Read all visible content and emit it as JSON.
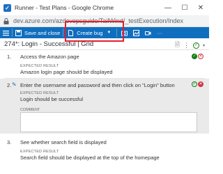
{
  "window": {
    "title": "Runner - Test Plans - Google Chrome",
    "url": "dev.azure.com/azdevopsguide/TailWind/_testExecution/Index",
    "minimize": "—",
    "maximize": "☐",
    "close": "✕"
  },
  "toolbar": {
    "save_close_label": "Save and close",
    "create_bug_label": "Create bug",
    "highlight_color": "#e81c2a"
  },
  "header": {
    "title": "274*: Login - Successful | Grid"
  },
  "steps": [
    {
      "number": "1.",
      "action": "Access the Amazon page",
      "expected_label": "EXPECTED RESULT",
      "expected": "Amazon login page should be displayed",
      "status": "passed"
    },
    {
      "number": "2.",
      "action": "Enter the username and password and then click on \"Login\" button",
      "expected_label": "EXPECTED RESULT",
      "expected": "Login should be successful",
      "comment_label": "COMMENT",
      "status": "failed"
    },
    {
      "number": "3.",
      "action": "See whether search field is displayed",
      "expected_label": "EXPECTED RESULT",
      "expected": "Search field should be displayed at the top of the homepage",
      "status": "none"
    }
  ],
  "colors": {
    "toolbar_bg": "#106ebe",
    "pass": "#107c10",
    "fail": "#d13438"
  }
}
